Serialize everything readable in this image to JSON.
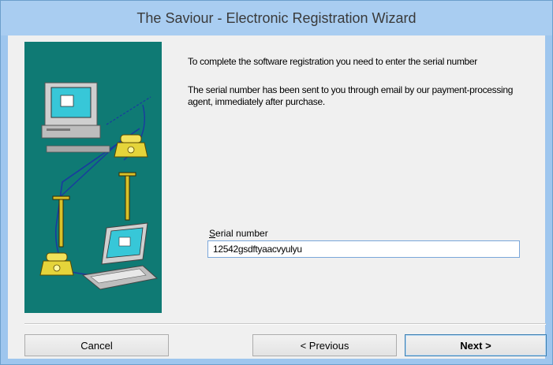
{
  "window": {
    "title": "The Saviour - Electronic Registration Wizard"
  },
  "content": {
    "intro": "To complete the software registration you need to enter the serial number",
    "info": "The serial number has been sent to you through email by our payment-processing agent, immediately after purchase."
  },
  "serial": {
    "label": "Serial number",
    "value": "12542gsdftyaacvyulyu"
  },
  "buttons": {
    "cancel": "Cancel",
    "previous": "< Previous",
    "next": "Next >"
  },
  "colors": {
    "title_bar": "#a9cdf1",
    "illustration_bg": "#0f7a74"
  }
}
